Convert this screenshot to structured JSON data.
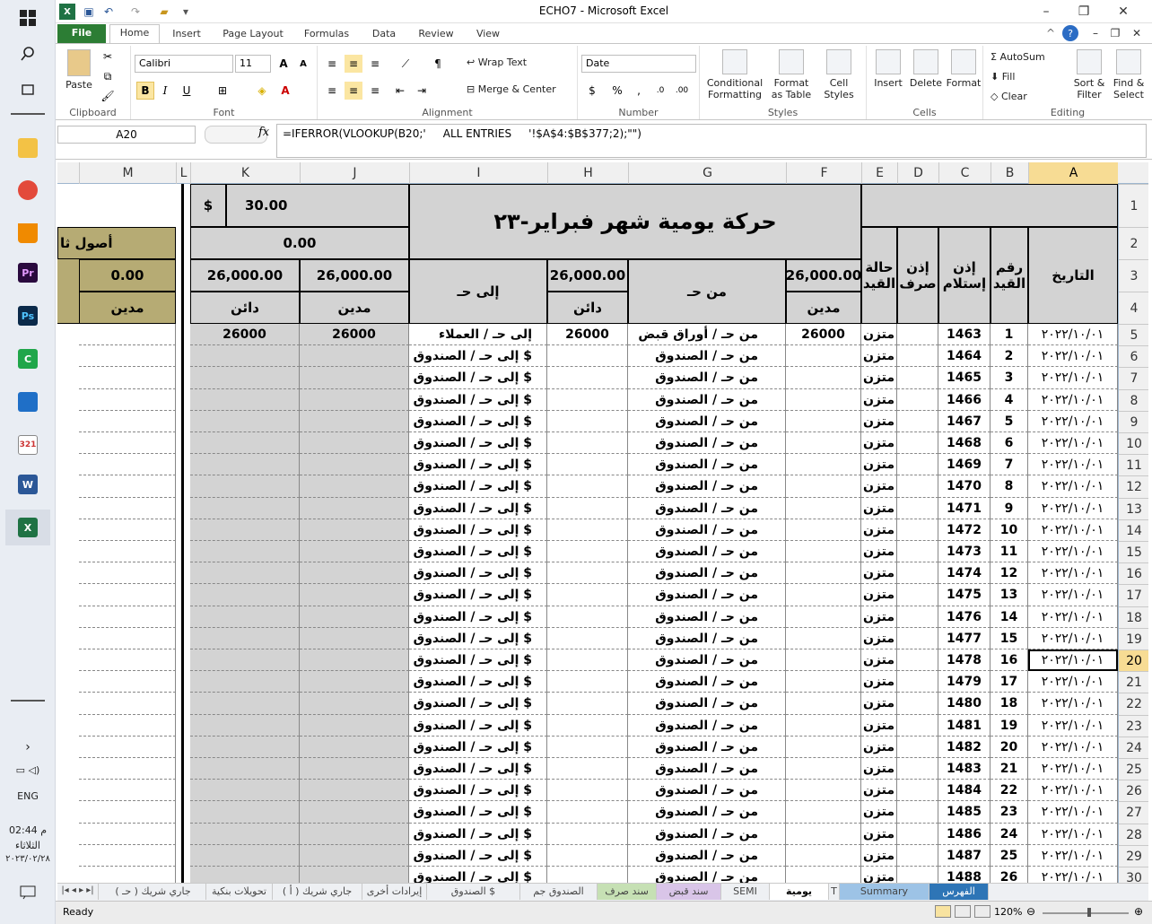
{
  "window": {
    "title": "ECHO7  -  Microsoft Excel"
  },
  "taskbar": {
    "language": "ENG",
    "time": "02:44 م",
    "day": "الثلاثاء",
    "date": "٢٠٢٣/٠٢/٢٨"
  },
  "ribbon_tabs": [
    "File",
    "Home",
    "Insert",
    "Page Layout",
    "Formulas",
    "Data",
    "Review",
    "View"
  ],
  "ribbon": {
    "paste": "Paste",
    "clipboard": "Clipboard",
    "font_name": "Calibri",
    "font_size": "11",
    "font": "Font",
    "wrap_text": "Wrap Text",
    "merge_center": "Merge & Center",
    "alignment": "Alignment",
    "number_format": "Date",
    "number": "Number",
    "cond_format": "Conditional Formatting",
    "format_table": "Format as Table",
    "cell_styles": "Cell Styles",
    "styles": "Styles",
    "insert": "Insert",
    "delete": "Delete",
    "format": "Format",
    "cells": "Cells",
    "autosum": "AutoSum",
    "fill": "Fill",
    "clear": "Clear",
    "sort_filter": "Sort & Filter",
    "find_select": "Find & Select",
    "editing": "Editing"
  },
  "formula_bar": {
    "name_box": "A20",
    "fx": "fx",
    "formula": "=IFERROR(VLOOKUP(B20;'     ALL ENTRIES     '!$A$4:$B$377;2);\"\")"
  },
  "columns": [
    "M",
    "L",
    "K",
    "J",
    "I",
    "H",
    "G",
    "F",
    "E",
    "D",
    "C",
    "B",
    "A"
  ],
  "selected_column": "A",
  "selected_row": 20,
  "header": {
    "title": "حركة يومية شهر فبراير-٢٣",
    "rate_symbol": "$",
    "rate_value": "30.00",
    "k2_value": "0.00",
    "m_title": "أصول ثا",
    "m_value": "0.00",
    "m_label": "مدين",
    "col_date": "التاريخ",
    "col_entry_no": "رقم القيد",
    "col_receipt": "إذن إستلام",
    "col_payment": "إذن صرف",
    "col_status": "حالة القيد",
    "col_from": "من حـ",
    "col_to": "إلى حـ",
    "total_f": "26,000.00",
    "total_h": "26,000.00",
    "total_j": "26,000.00",
    "total_k": "26,000.00",
    "label_debit": "مدين",
    "label_credit": "دائن"
  },
  "rows": [
    {
      "row": 5,
      "date": "٢٠٢٢/١٠/٠١",
      "entry": "1",
      "receipt": "1463",
      "status": "متزن",
      "debit": "26000",
      "from": "من حـ / أوراق قبض",
      "credit": "26000",
      "to": "إلى حـ / العملاء",
      "j": "26000",
      "k": "26000"
    },
    {
      "row": 6,
      "date": "٢٠٢٢/١٠/٠١",
      "entry": "2",
      "receipt": "1464",
      "status": "متزن",
      "debit": "",
      "from": "من حـ / الصندوق",
      "credit": "",
      "to": "إلى حـ / الصندوق $",
      "j": "",
      "k": ""
    },
    {
      "row": 7,
      "date": "٢٠٢٢/١٠/٠١",
      "entry": "3",
      "receipt": "1465",
      "status": "متزن",
      "debit": "",
      "from": "من حـ / الصندوق",
      "credit": "",
      "to": "إلى حـ / الصندوق $",
      "j": "",
      "k": ""
    },
    {
      "row": 8,
      "date": "٢٠٢٢/١٠/٠١",
      "entry": "4",
      "receipt": "1466",
      "status": "متزن",
      "debit": "",
      "from": "من حـ / الصندوق",
      "credit": "",
      "to": "إلى حـ / الصندوق $",
      "j": "",
      "k": ""
    },
    {
      "row": 9,
      "date": "٢٠٢٢/١٠/٠١",
      "entry": "5",
      "receipt": "1467",
      "status": "متزن",
      "debit": "",
      "from": "من حـ / الصندوق",
      "credit": "",
      "to": "إلى حـ / الصندوق $",
      "j": "",
      "k": ""
    },
    {
      "row": 10,
      "date": "٢٠٢٢/١٠/٠١",
      "entry": "6",
      "receipt": "1468",
      "status": "متزن",
      "debit": "",
      "from": "من حـ / الصندوق",
      "credit": "",
      "to": "إلى حـ / الصندوق $",
      "j": "",
      "k": ""
    },
    {
      "row": 11,
      "date": "٢٠٢٢/١٠/٠١",
      "entry": "7",
      "receipt": "1469",
      "status": "متزن",
      "debit": "",
      "from": "من حـ / الصندوق",
      "credit": "",
      "to": "إلى حـ / الصندوق $",
      "j": "",
      "k": ""
    },
    {
      "row": 12,
      "date": "٢٠٢٢/١٠/٠١",
      "entry": "8",
      "receipt": "1470",
      "status": "متزن",
      "debit": "",
      "from": "من حـ / الصندوق",
      "credit": "",
      "to": "إلى حـ / الصندوق $",
      "j": "",
      "k": ""
    },
    {
      "row": 13,
      "date": "٢٠٢٢/١٠/٠١",
      "entry": "9",
      "receipt": "1471",
      "status": "متزن",
      "debit": "",
      "from": "من حـ / الصندوق",
      "credit": "",
      "to": "إلى حـ / الصندوق $",
      "j": "",
      "k": ""
    },
    {
      "row": 14,
      "date": "٢٠٢٢/١٠/٠١",
      "entry": "10",
      "receipt": "1472",
      "status": "متزن",
      "debit": "",
      "from": "من حـ / الصندوق",
      "credit": "",
      "to": "إلى حـ / الصندوق $",
      "j": "",
      "k": ""
    },
    {
      "row": 15,
      "date": "٢٠٢٢/١٠/٠١",
      "entry": "11",
      "receipt": "1473",
      "status": "متزن",
      "debit": "",
      "from": "من حـ / الصندوق",
      "credit": "",
      "to": "إلى حـ / الصندوق $",
      "j": "",
      "k": ""
    },
    {
      "row": 16,
      "date": "٢٠٢٢/١٠/٠١",
      "entry": "12",
      "receipt": "1474",
      "status": "متزن",
      "debit": "",
      "from": "من حـ / الصندوق",
      "credit": "",
      "to": "إلى حـ / الصندوق $",
      "j": "",
      "k": ""
    },
    {
      "row": 17,
      "date": "٢٠٢٢/١٠/٠١",
      "entry": "13",
      "receipt": "1475",
      "status": "متزن",
      "debit": "",
      "from": "من حـ / الصندوق",
      "credit": "",
      "to": "إلى حـ / الصندوق $",
      "j": "",
      "k": ""
    },
    {
      "row": 18,
      "date": "٢٠٢٢/١٠/٠١",
      "entry": "14",
      "receipt": "1476",
      "status": "متزن",
      "debit": "",
      "from": "من حـ / الصندوق",
      "credit": "",
      "to": "إلى حـ / الصندوق $",
      "j": "",
      "k": ""
    },
    {
      "row": 19,
      "date": "٢٠٢٢/١٠/٠١",
      "entry": "15",
      "receipt": "1477",
      "status": "متزن",
      "debit": "",
      "from": "من حـ / الصندوق",
      "credit": "",
      "to": "إلى حـ / الصندوق $",
      "j": "",
      "k": ""
    },
    {
      "row": 20,
      "date": "٢٠٢٢/١٠/٠١",
      "entry": "16",
      "receipt": "1478",
      "status": "متزن",
      "debit": "",
      "from": "من حـ / الصندوق",
      "credit": "",
      "to": "إلى حـ / الصندوق $",
      "j": "",
      "k": ""
    },
    {
      "row": 21,
      "date": "٢٠٢٢/١٠/٠١",
      "entry": "17",
      "receipt": "1479",
      "status": "متزن",
      "debit": "",
      "from": "من حـ / الصندوق",
      "credit": "",
      "to": "إلى حـ / الصندوق $",
      "j": "",
      "k": ""
    },
    {
      "row": 22,
      "date": "٢٠٢٢/١٠/٠١",
      "entry": "18",
      "receipt": "1480",
      "status": "متزن",
      "debit": "",
      "from": "من حـ / الصندوق",
      "credit": "",
      "to": "إلى حـ / الصندوق $",
      "j": "",
      "k": ""
    },
    {
      "row": 23,
      "date": "٢٠٢٢/١٠/٠١",
      "entry": "19",
      "receipt": "1481",
      "status": "متزن",
      "debit": "",
      "from": "من حـ / الصندوق",
      "credit": "",
      "to": "إلى حـ / الصندوق $",
      "j": "",
      "k": ""
    },
    {
      "row": 24,
      "date": "٢٠٢٢/١٠/٠١",
      "entry": "20",
      "receipt": "1482",
      "status": "متزن",
      "debit": "",
      "from": "من حـ / الصندوق",
      "credit": "",
      "to": "إلى حـ / الصندوق $",
      "j": "",
      "k": ""
    },
    {
      "row": 25,
      "date": "٢٠٢٢/١٠/٠١",
      "entry": "21",
      "receipt": "1483",
      "status": "متزن",
      "debit": "",
      "from": "من حـ / الصندوق",
      "credit": "",
      "to": "إلى حـ / الصندوق $",
      "j": "",
      "k": ""
    },
    {
      "row": 26,
      "date": "٢٠٢٢/١٠/٠١",
      "entry": "22",
      "receipt": "1484",
      "status": "متزن",
      "debit": "",
      "from": "من حـ / الصندوق",
      "credit": "",
      "to": "إلى حـ / الصندوق $",
      "j": "",
      "k": ""
    },
    {
      "row": 27,
      "date": "٢٠٢٢/١٠/٠١",
      "entry": "23",
      "receipt": "1485",
      "status": "متزن",
      "debit": "",
      "from": "من حـ / الصندوق",
      "credit": "",
      "to": "إلى حـ / الصندوق $",
      "j": "",
      "k": ""
    },
    {
      "row": 28,
      "date": "٢٠٢٢/١٠/٠١",
      "entry": "24",
      "receipt": "1486",
      "status": "متزن",
      "debit": "",
      "from": "من حـ / الصندوق",
      "credit": "",
      "to": "إلى حـ / الصندوق $",
      "j": "",
      "k": ""
    },
    {
      "row": 29,
      "date": "٢٠٢٢/١٠/٠١",
      "entry": "25",
      "receipt": "1487",
      "status": "متزن",
      "debit": "",
      "from": "من حـ / الصندوق",
      "credit": "",
      "to": "إلى حـ / الصندوق $",
      "j": "",
      "k": ""
    },
    {
      "row": 30,
      "date": "٢٠٢٢/١٠/٠١",
      "entry": "26",
      "receipt": "1488",
      "status": "متزن",
      "debit": "",
      "from": "من حـ / الصندوق",
      "credit": "",
      "to": "إلى حـ / الصندوق $",
      "j": "",
      "k": ""
    }
  ],
  "sheet_tabs": [
    "جاري شريك ( حـ )",
    "تحويلات بنكية",
    "جاري شريك ( أ )",
    "إيرادات أخرى",
    "الصندوق $",
    "الصندوق جم",
    "سند صرف",
    "سند قبض",
    "SEMI",
    "يومية",
    "T",
    "Summary",
    "الفهرس"
  ],
  "active_sheet": "يومية",
  "status": {
    "ready": "Ready",
    "zoom": "120%"
  },
  "colors": {
    "file_tab": "#2c7d34",
    "selection": "#f7dc94",
    "grey_cell": "#d3d3d3",
    "olive_cell": "#b6ab74"
  }
}
